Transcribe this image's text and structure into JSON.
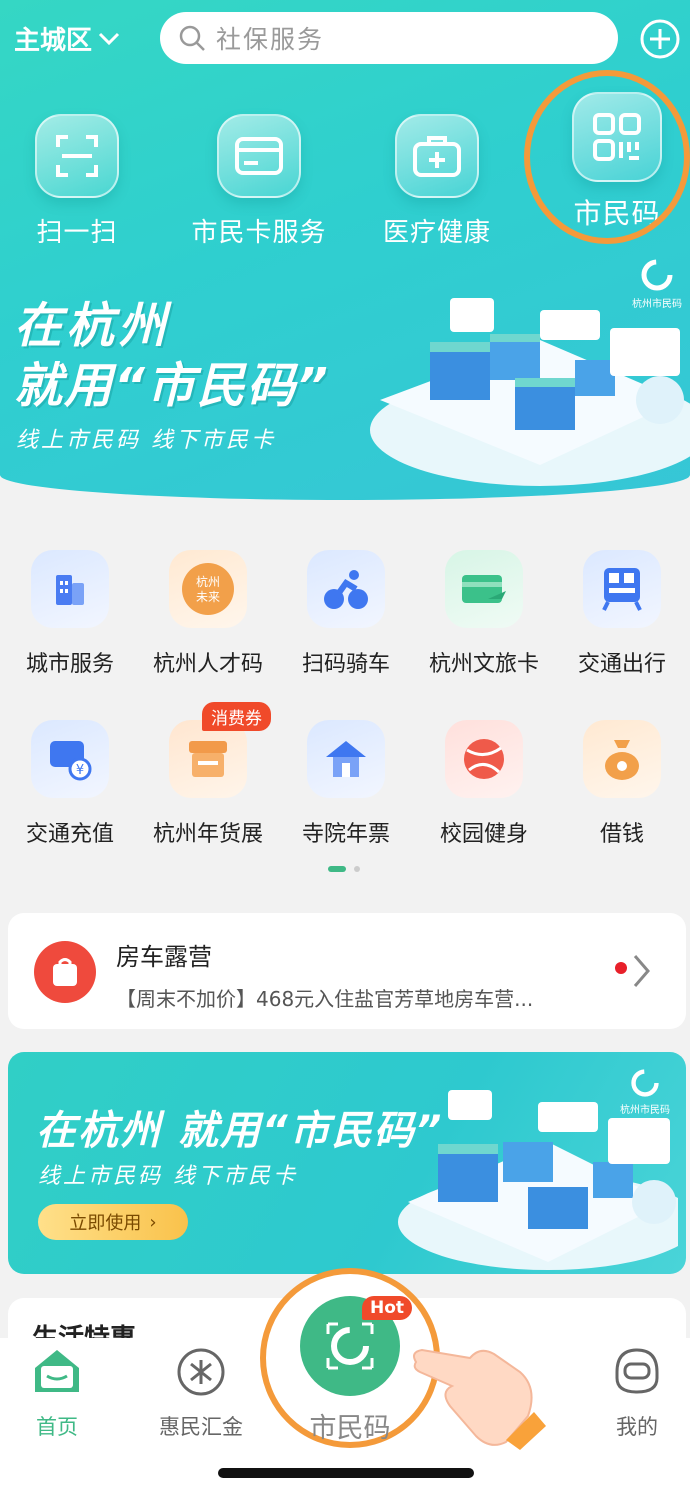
{
  "header": {
    "city": "主城区",
    "search_placeholder": "社保服务"
  },
  "quick_actions": [
    {
      "label": "扫一扫",
      "icon": "scan-icon"
    },
    {
      "label": "市民卡服务",
      "icon": "card-icon"
    },
    {
      "label": "医疗健康",
      "icon": "medical-kit-icon"
    },
    {
      "label": "市民码",
      "icon": "qr-code-icon"
    }
  ],
  "hero_banner": {
    "line1": "在杭州",
    "line2": "就用“市民码”",
    "line3": "线上市民码  线下市民卡",
    "brand": "杭州市民码"
  },
  "services": [
    {
      "label": "城市服务",
      "icon": "building-icon",
      "color": "#4a7cf2"
    },
    {
      "label": "杭州人才码",
      "icon": "talent-code-icon",
      "color": "#f2a04a"
    },
    {
      "label": "扫码骑车",
      "icon": "bicycle-icon",
      "color": "#3f77f0"
    },
    {
      "label": "杭州文旅卡",
      "icon": "travel-card-icon",
      "color": "#3bc18a"
    },
    {
      "label": "交通出行",
      "icon": "bus-icon",
      "color": "#3f77f0"
    },
    {
      "label": "交通充值",
      "icon": "transit-recharge-icon",
      "color": "#3f77f0"
    },
    {
      "label": "杭州年货展",
      "icon": "shop-icon",
      "color": "#f29a4a"
    },
    {
      "label": "寺院年票",
      "icon": "temple-icon",
      "color": "#3f77f0"
    },
    {
      "label": "校园健身",
      "icon": "ball-icon",
      "color": "#ef5a4a"
    },
    {
      "label": "借钱",
      "icon": "money-bag-icon",
      "color": "#f2a04a"
    }
  ],
  "service_badge": "消费券",
  "notice": {
    "title": "房车露营",
    "subtitle": "【周末不加价】468元入住盐官芳草地房车营..."
  },
  "promo_banner": {
    "line1": "在杭州 就用“市民码”",
    "line2": "线上市民码  线下市民卡",
    "button": "立即使用",
    "brand": "杭州市民码"
  },
  "section_title": "生活特惠",
  "tabbar": {
    "home": "首页",
    "finance": "惠民汇金",
    "center": "市民码",
    "center_badge": "Hot",
    "mine": "我的"
  },
  "colors": {
    "accent": "#2fcfcf",
    "highlight": "#f49a3a",
    "home_green": "#3fb986"
  }
}
